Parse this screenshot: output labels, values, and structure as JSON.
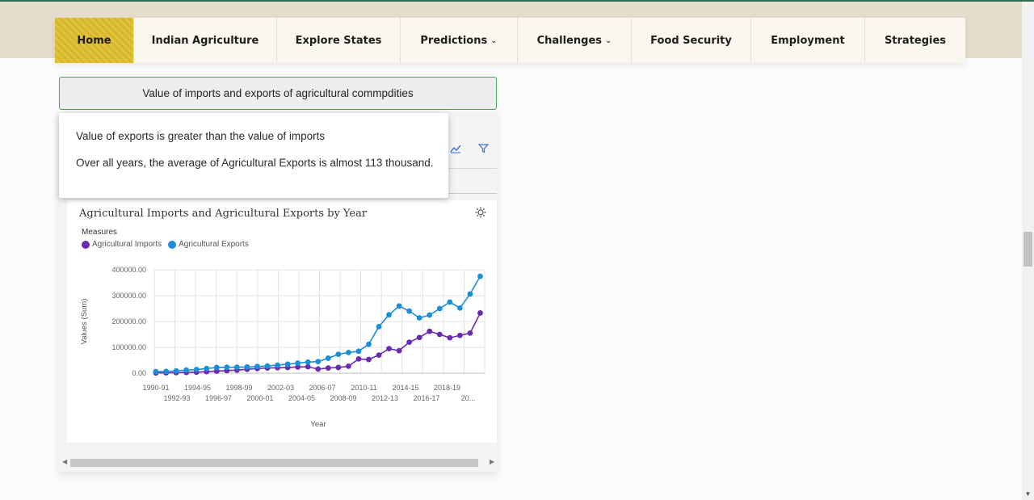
{
  "nav": {
    "items": [
      {
        "label": "Home",
        "active": true,
        "dropdown": false
      },
      {
        "label": "Indian Agriculture",
        "active": false,
        "dropdown": false
      },
      {
        "label": "Explore States",
        "active": false,
        "dropdown": false
      },
      {
        "label": "Predictions",
        "active": false,
        "dropdown": true
      },
      {
        "label": "Challenges",
        "active": false,
        "dropdown": true
      },
      {
        "label": "Food Security",
        "active": false,
        "dropdown": false
      },
      {
        "label": "Employment",
        "active": false,
        "dropdown": false
      },
      {
        "label": "Strategies",
        "active": false,
        "dropdown": false
      }
    ]
  },
  "accordion": {
    "title": "Value of imports and exports of agricultural commpdities"
  },
  "insights": {
    "line1": "Value of exports is greater than the value of imports",
    "line2": "Over all years, the average of Agricultural Exports is almost 113 thousand."
  },
  "icons": {
    "line_chart": "line-chart-icon",
    "filter": "filter-icon",
    "settings": "settings-icon"
  },
  "colors": {
    "imports": "#6a2bb0",
    "exports": "#1a8fd8",
    "active_nav": "#d8b62a"
  },
  "chart_data": {
    "type": "line",
    "title": "Agricultural Imports and Agricultural Exports by Year",
    "legend_title": "Measures",
    "xlabel": "Year",
    "ylabel": "Values (Sum)",
    "ylim": [
      0,
      400000
    ],
    "y_ticks": [
      "0.00",
      "100000.00",
      "200000.00",
      "300000.00",
      "400000.00"
    ],
    "x_tick_labels_row1": [
      "1990-91",
      "1994-95",
      "1998-99",
      "2002-03",
      "2006-07",
      "2010-11",
      "2014-15",
      "2018-19"
    ],
    "x_tick_labels_row2": [
      "1992-93",
      "1996-97",
      "2000-01",
      "2004-05",
      "2008-09",
      "2012-13",
      "2016-17",
      "20..."
    ],
    "series": [
      {
        "name": "Agricultural Imports",
        "color": "#6a2bb0",
        "values": [
          1000,
          1500,
          2000,
          3000,
          4000,
          6000,
          8000,
          10000,
          12000,
          15000,
          18000,
          20000,
          21000,
          22000,
          24000,
          25000,
          16000,
          20000,
          22000,
          27000,
          55000,
          53000,
          70000,
          95000,
          87000,
          120000,
          138000,
          162000,
          150000,
          137000,
          146000,
          155000,
          233000
        ]
      },
      {
        "name": "Agricultural Exports",
        "color": "#1a8fd8",
        "values": [
          6000,
          7000,
          9000,
          12000,
          14000,
          18000,
          22000,
          23000,
          23000,
          24000,
          26000,
          28000,
          31000,
          35000,
          39000,
          43000,
          45000,
          58000,
          73000,
          80000,
          85000,
          112000,
          180000,
          226000,
          260000,
          240000,
          214000,
          225000,
          250000,
          275000,
          252000,
          306000,
          375000
        ]
      }
    ]
  }
}
